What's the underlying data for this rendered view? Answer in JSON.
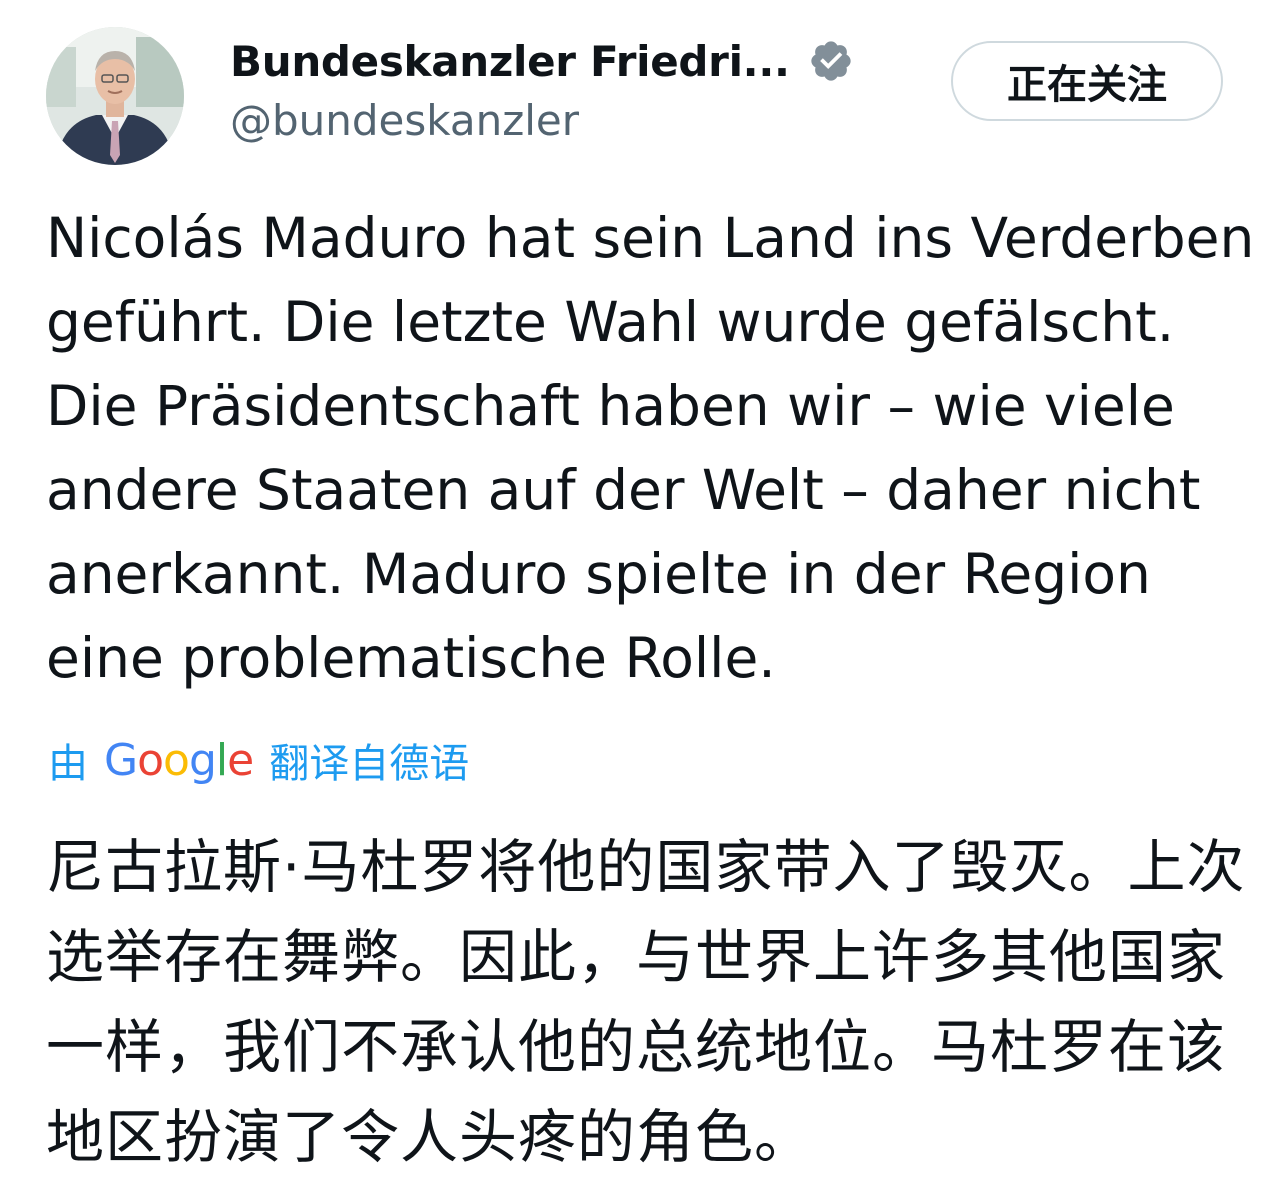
{
  "tweet": {
    "author": {
      "display_name": "Bundeskanzler Friedri...",
      "handle": "@bundeskanzler",
      "verified_icon": "verified-badge-icon",
      "verified_color": "#828f99"
    },
    "follow_button_label": "正在关注",
    "text": "Nicolás Maduro hat sein Land ins Verderben geführt. Die letzte Wahl wurde gefälscht. Die Präsidentschaft haben wir – wie viele andere Staaten auf der Welt – daher nicht anerkannt. Maduro spielte in der Region eine problematische Rolle.",
    "translation": {
      "prefix": "由",
      "provider": "Google",
      "suffix": "翻译自德语",
      "link_color": "#1d9bf0",
      "provider_colors": [
        "#4285f4",
        "#ea4335",
        "#fbbc05",
        "#4285f4",
        "#34a853",
        "#ea4335"
      ],
      "text": "尼古拉斯·马杜罗将他的国家带入了毁灭。上次选举存在舞弊。因此，与世界上许多其他国家一样，我们不承认他的总统地位。马杜罗在该地区扮演了令人头疼的角色。"
    }
  }
}
